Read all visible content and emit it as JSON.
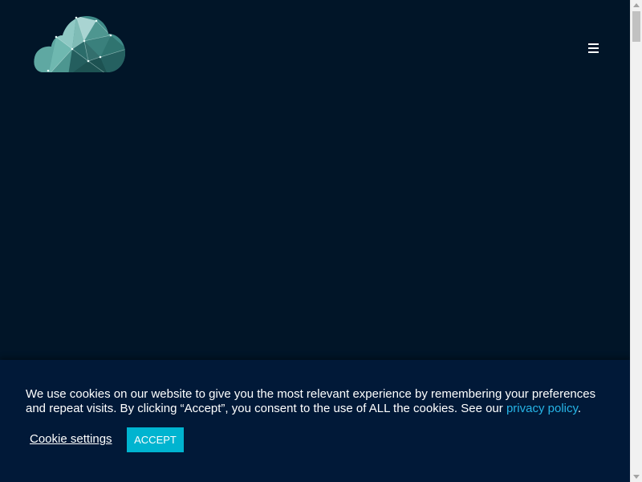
{
  "header": {
    "logo_icon": "polygon-cloud-logo",
    "menu_icon": "hamburger-menu-icon"
  },
  "cookie_banner": {
    "message": "We use cookies on our website to give you the most relevant experience by remembering your preferences and repeat visits. By clicking “Accept”, you consent to the use of ALL the cookies. See our ",
    "policy_link_label": "privacy policy",
    "message_end": ".",
    "settings_label": "Cookie settings",
    "accept_label": "ACCEPT"
  },
  "colors": {
    "page_background": "#011528",
    "banner_background": "#011938",
    "link": "#26b4e6",
    "accept_button": "#00b4d0",
    "logo_teal": "#3d8c8c"
  }
}
